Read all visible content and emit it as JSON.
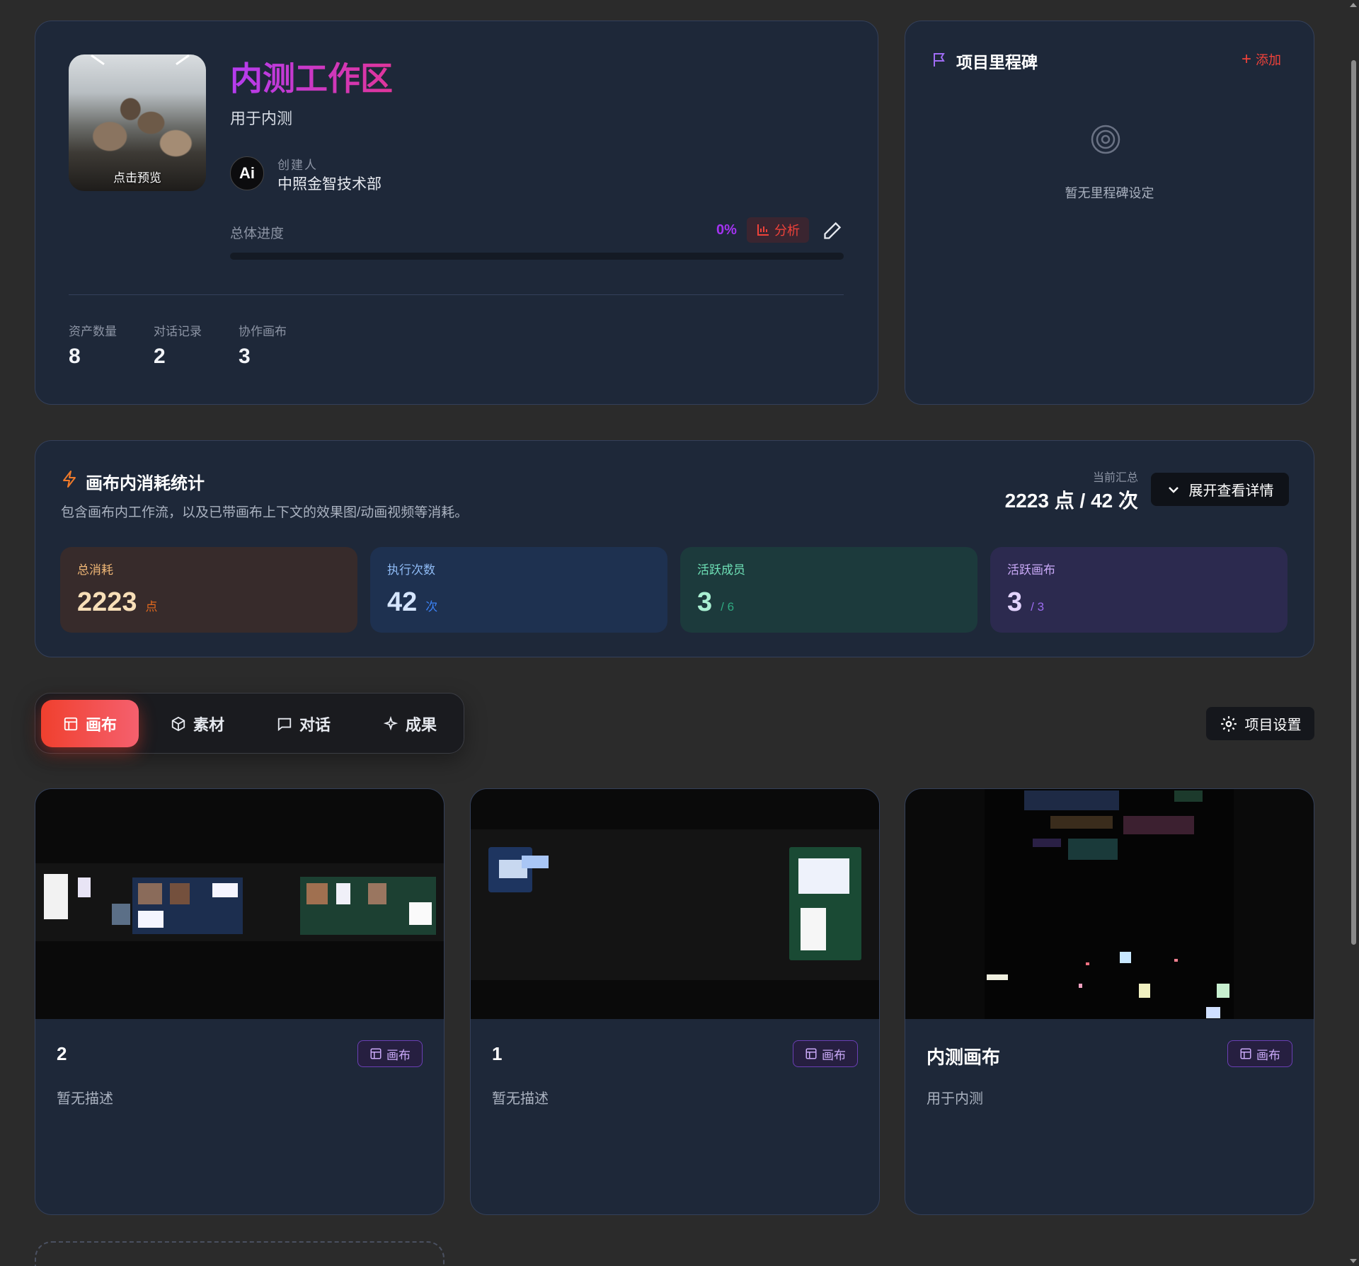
{
  "workspace": {
    "cover_label": "点击预览",
    "title": "内测工作区",
    "subtitle": "用于内测",
    "creator_avatar_text": "Ai",
    "creator_label": "创建人",
    "creator_name": "中照金智技术部",
    "progress_label": "总体进度",
    "progress_value": "0%",
    "progress_fraction": 0,
    "analyze_label": "分析",
    "stats": [
      {
        "label": "资产数量",
        "value": "8"
      },
      {
        "label": "对话记录",
        "value": "2"
      },
      {
        "label": "协作画布",
        "value": "3"
      }
    ]
  },
  "milestones": {
    "title": "项目里程碑",
    "add_label": "添加",
    "empty_text": "暂无里程碑设定"
  },
  "consumption": {
    "title": "画布内消耗统计",
    "description": "包含画布内工作流，以及已带画布上下文的效果图/动画视频等消耗。",
    "summary_label": "当前汇总",
    "summary_value": "2223 点 / 42 次",
    "expand_label": "展开查看详情",
    "metrics": [
      {
        "label": "总消耗",
        "value": "2223",
        "unit": "点"
      },
      {
        "label": "执行次数",
        "value": "42",
        "unit": "次"
      },
      {
        "label": "活跃成员",
        "value": "3",
        "unit": "/ 6"
      },
      {
        "label": "活跃画布",
        "value": "3",
        "unit": "/ 3"
      }
    ]
  },
  "tabs": [
    {
      "label": "画布",
      "icon": "layout-icon",
      "active": true
    },
    {
      "label": "素材",
      "icon": "cube-icon",
      "active": false
    },
    {
      "label": "对话",
      "icon": "chat-icon",
      "active": false
    },
    {
      "label": "成果",
      "icon": "sparkle-icon",
      "active": false
    }
  ],
  "settings_label": "项目设置",
  "canvases": [
    {
      "title": "2",
      "badge": "画布",
      "description": "暂无描述"
    },
    {
      "title": "1",
      "badge": "画布",
      "description": "暂无描述"
    },
    {
      "title": "内测画布",
      "badge": "画布",
      "description": "用于内测"
    }
  ],
  "colors": {
    "accent_red": "#f0423a",
    "accent_purple": "#a333f0",
    "card_bg": "#1e2839",
    "page_bg": "#2b2b2b"
  }
}
